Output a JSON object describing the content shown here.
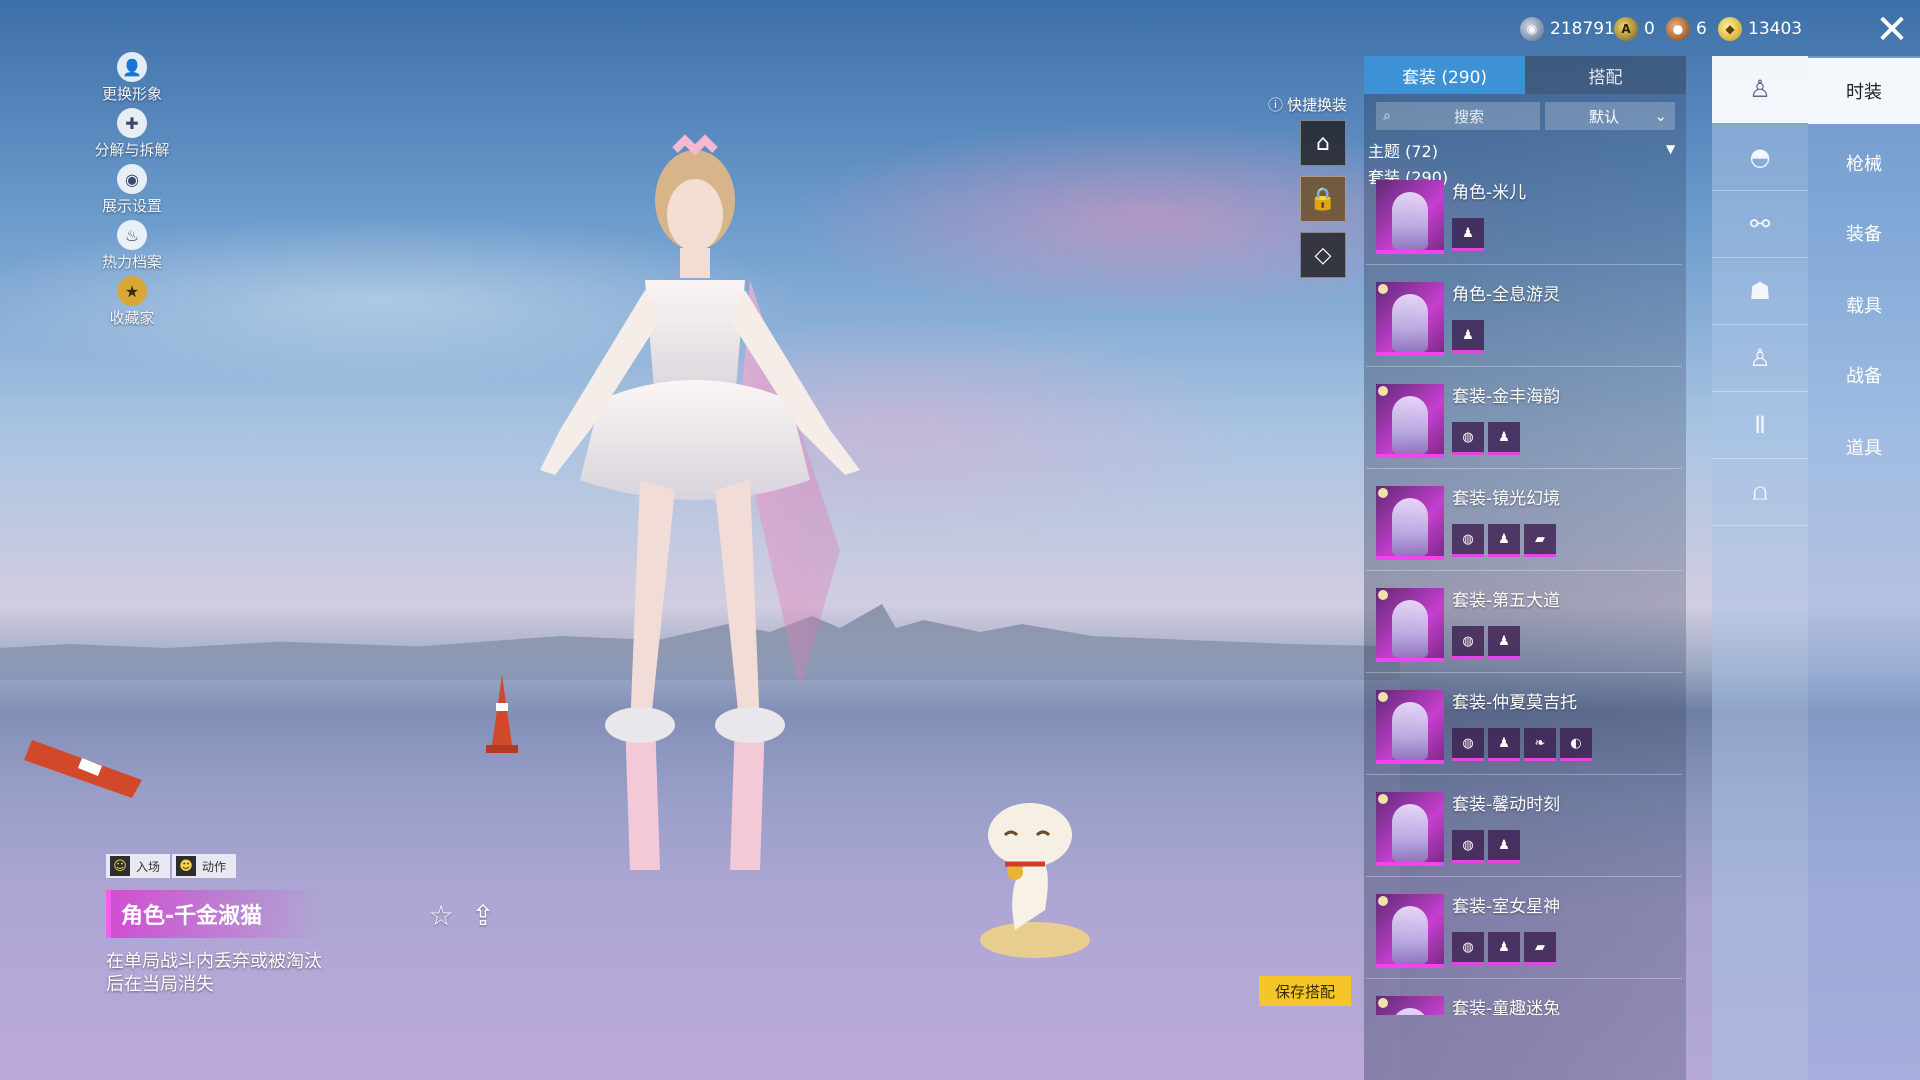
{
  "currencies": [
    {
      "icon": "uc-coin-icon",
      "value": "218791"
    },
    {
      "icon": "ag-coin-icon",
      "value": "0"
    },
    {
      "icon": "bronze-coin-icon",
      "value": "6"
    },
    {
      "icon": "gold-coin-icon",
      "value": "13403"
    }
  ],
  "left_menu": [
    {
      "name": "change-appearance",
      "label": "更换形象",
      "icon": "person-icon"
    },
    {
      "name": "decompose",
      "label": "分解与拆解",
      "icon": "puzzle-icon"
    },
    {
      "name": "display-settings",
      "label": "展示设置",
      "icon": "eye-icon"
    },
    {
      "name": "heat-record",
      "label": "热力档案",
      "icon": "flame-icon"
    },
    {
      "name": "collector",
      "label": "收藏家",
      "icon": "badge-icon"
    }
  ],
  "character": {
    "tag_entry": "入场",
    "tag_action": "动作",
    "title": "角色-千金淑猫",
    "description": "在单局战斗内丢弃或被淘汰后在当局消失"
  },
  "quick_change": {
    "label": "快捷换装"
  },
  "save_button": "保存搭配",
  "tabs": {
    "suits": "套装 (290)",
    "match": "搭配"
  },
  "search": {
    "placeholder": "搜索",
    "sort": "默认"
  },
  "sections": {
    "theme": "主题 (72)",
    "suits": "套装 (290)"
  },
  "outfits": [
    {
      "name": "角色-米儿",
      "parts": 1
    },
    {
      "name": "角色-全息游灵",
      "parts": 1
    },
    {
      "name": "套装-金丰海韵",
      "parts": 2
    },
    {
      "name": "套装-镜光幻境",
      "parts": 3
    },
    {
      "name": "套装-第五大道",
      "parts": 2
    },
    {
      "name": "套装-仲夏莫吉托",
      "parts": 4
    },
    {
      "name": "套装-馨动时刻",
      "parts": 2
    },
    {
      "name": "套装-室女星神",
      "parts": 3
    },
    {
      "name": "套装-童趣迷兔",
      "parts": 0
    }
  ],
  "category_icons": [
    "outfit-icon",
    "helmet-icon",
    "glasses-icon",
    "mask-icon",
    "top-icon",
    "pants-icon",
    "shoes-icon"
  ],
  "side_nav": [
    "时装",
    "枪械",
    "装备",
    "载具",
    "战备",
    "道具"
  ]
}
